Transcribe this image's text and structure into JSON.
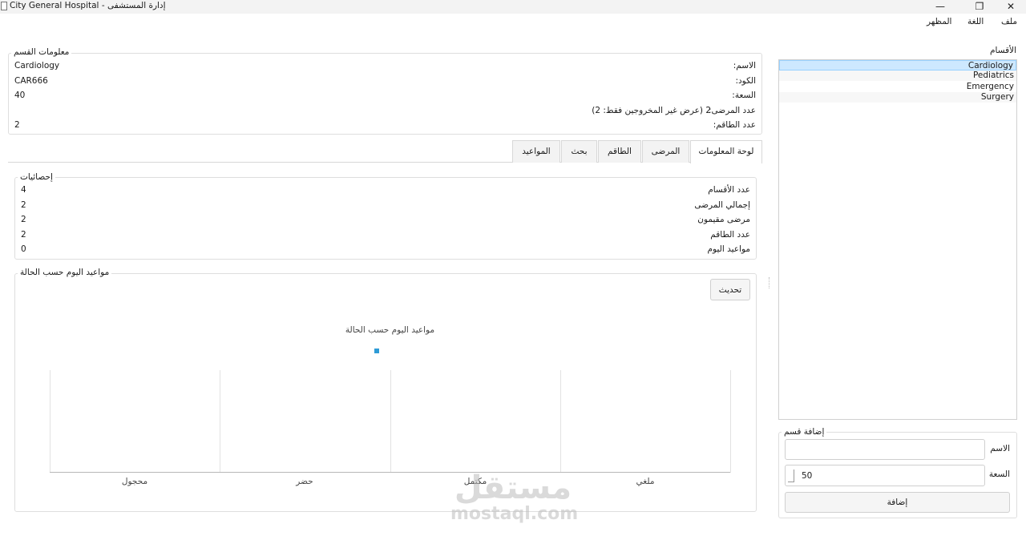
{
  "window": {
    "title": "City General Hospital - إدارة المستشفى"
  },
  "menu": {
    "file": "ملف",
    "language": "اللغة",
    "appearance": "المظهر"
  },
  "department_info": {
    "group_title": "معلومات القسم",
    "name_label": "الاسم:",
    "name_value": "Cardiology",
    "code_label": "الكود:",
    "code_value": "CAR666",
    "capacity_label": "السعة:",
    "capacity_value": "40",
    "patients_label": "عدد المرضى:",
    "patients_value": "2 (عرض غير المخروجين فقط: 2)",
    "staff_label": "عدد الطاقم:",
    "staff_value": "2"
  },
  "tabs": [
    {
      "label": "لوحة المعلومات",
      "active": true
    },
    {
      "label": "المرضى"
    },
    {
      "label": "الطاقم"
    },
    {
      "label": "بحث"
    },
    {
      "label": "المواعيد"
    }
  ],
  "stats": {
    "group_title": "إحصائيات",
    "rows": [
      {
        "label": "عدد الأقسام",
        "value": "4"
      },
      {
        "label": "إجمالي المرضى",
        "value": "2"
      },
      {
        "label": "مرضى مقيمون",
        "value": "2"
      },
      {
        "label": "عدد الطاقم",
        "value": "2"
      },
      {
        "label": "مواعيد اليوم",
        "value": "0"
      }
    ]
  },
  "appointments": {
    "group_title": "مواعيد اليوم حسب الحالة",
    "refresh_label": "تحديث"
  },
  "chart_data": {
    "type": "bar",
    "title": "مواعيد اليوم حسب الحالة",
    "categories": [
      "محجول",
      "حضر",
      "مكتمل",
      "ملغي"
    ],
    "values": [
      0,
      0,
      0,
      0
    ],
    "legend_color": "#2e9bd6",
    "legend_placement": "top-center"
  },
  "departments": {
    "title": "الأقسام",
    "items": [
      "Cardiology",
      "Pediatrics",
      "Emergency",
      "Surgery"
    ],
    "selected_index": 0
  },
  "add_department": {
    "group_title": "إضافة قسم",
    "name_label": "الاسم",
    "name_value": "",
    "capacity_label": "السعة",
    "capacity_value": "50",
    "add_label": "إضافة"
  },
  "watermark": {
    "arabic": "مستقل",
    "latin": "mostaql.com"
  },
  "colors": {
    "selection": "#cde8ff",
    "selection_border": "#99d1ff",
    "legend": "#2e9bd6"
  }
}
